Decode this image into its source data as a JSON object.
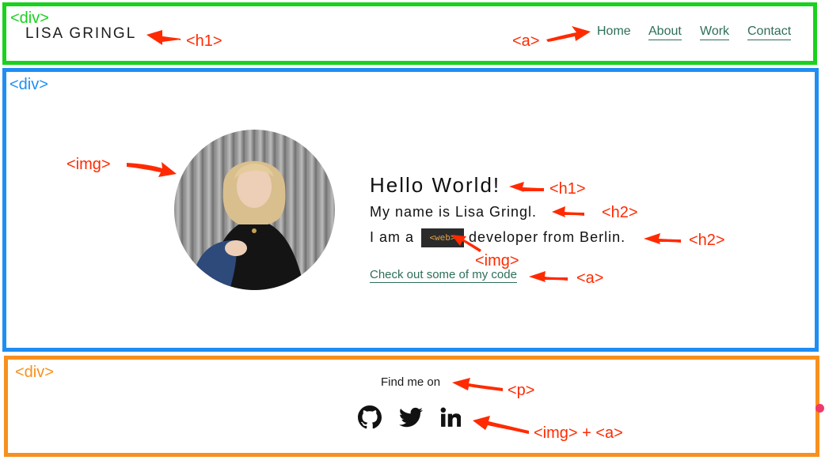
{
  "header": {
    "title": "LISA GRINGL",
    "nav": [
      {
        "label": "Home"
      },
      {
        "label": "About"
      },
      {
        "label": "Work"
      },
      {
        "label": "Contact"
      }
    ]
  },
  "main": {
    "heading": "Hello World!",
    "intro": "My name is Lisa Gringl.",
    "role_prefix": "I am a",
    "role_badge": "<web>",
    "role_suffix": "developer from Berlin.",
    "code_link": "Check out some of my code"
  },
  "footer": {
    "find_text": "Find me on",
    "social": [
      {
        "icon": "github-icon"
      },
      {
        "icon": "twitter-icon"
      },
      {
        "icon": "linkedin-icon"
      }
    ]
  },
  "annotations": {
    "header_div": "<div>",
    "title_tag": "<h1>",
    "nav_tag": "<a>",
    "main_div": "<div>",
    "img_tag": "<img>",
    "hello_tag": "<h1>",
    "intro_tag": "<h2>",
    "role_tag": "<h2>",
    "badge_tag": "<img>",
    "link_tag": "<a>",
    "footer_div": "<div>",
    "find_tag": "<p>",
    "social_tag": "<img> + <a>"
  },
  "colors": {
    "header_box": "#19d11e",
    "main_box": "#1e8ef2",
    "footer_box": "#f7901e",
    "annotation": "#ff2a00",
    "link": "#2e6e5b",
    "badge_bg": "#2b2b2b",
    "badge_text": "#e0a24a"
  }
}
